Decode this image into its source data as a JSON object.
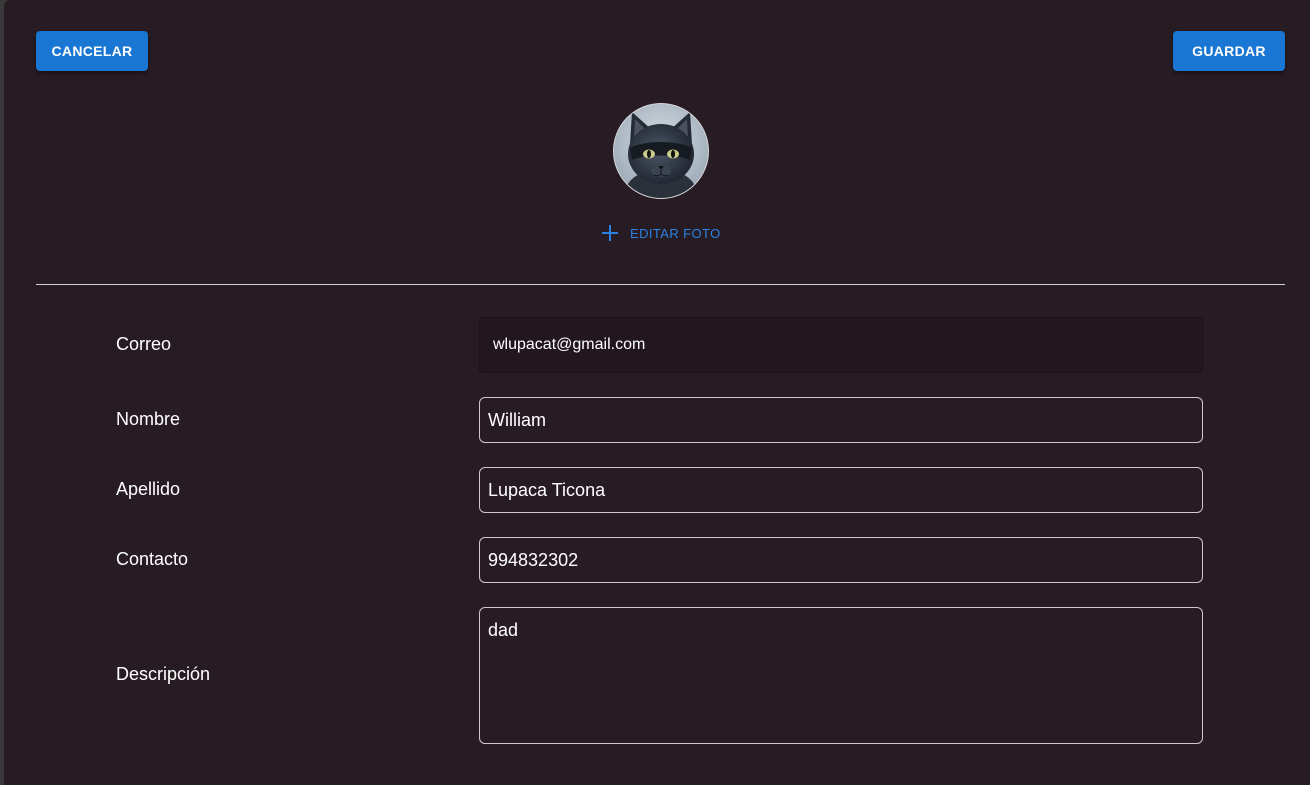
{
  "toolbar": {
    "cancel_label": "CANCELAR",
    "save_label": "GUARDAR"
  },
  "profile": {
    "edit_photo_label": "EDITAR FOTO",
    "edit_photo_icon": "plus-icon",
    "avatar_subject": "cat"
  },
  "form": {
    "email": {
      "label": "Correo",
      "value": "wlupacat@gmail.com"
    },
    "first_name": {
      "label": "Nombre",
      "value": "William"
    },
    "last_name": {
      "label": "Apellido",
      "value": "Lupaca Ticona"
    },
    "contact": {
      "label": "Contacto",
      "value": "994832302"
    },
    "description": {
      "label": "Descripción",
      "value": "dad"
    }
  },
  "colors": {
    "accent": "#1976d2",
    "background": "#281c24",
    "link": "#2a82e4"
  }
}
